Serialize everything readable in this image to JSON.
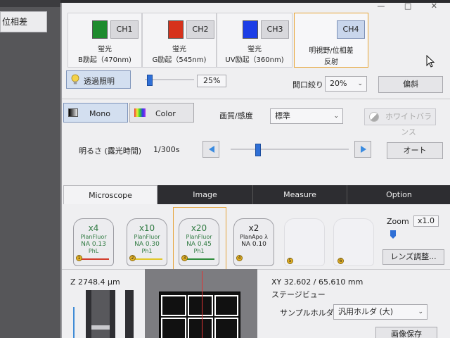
{
  "left": {
    "button_label": "位相差"
  },
  "window": {
    "controls": "—  □  ✕"
  },
  "channels": [
    {
      "label": "CH1",
      "name": "蛍光",
      "desc": "B励起（470nm)",
      "color": "#1f8b2e"
    },
    {
      "label": "CH2",
      "name": "蛍光",
      "desc": "G励起（545nm)",
      "color": "#d6321c"
    },
    {
      "label": "CH3",
      "name": "蛍光",
      "desc": "UV励起（360nm)",
      "color": "#1c3ee6"
    },
    {
      "label": "CH4",
      "name": "明視野/位相差",
      "desc": "反射",
      "color": ""
    }
  ],
  "illumination": {
    "button": "透過照明",
    "percent": "25%",
    "progress": 0.05,
    "aperture_label": "開口絞り",
    "aperture_value": "20%",
    "oblique_button": "偏斜"
  },
  "mode": {
    "mono": "Mono",
    "color": "Color",
    "quality_label": "画質/感度",
    "quality_value": "標準",
    "white_balance": "ホワイトバランス"
  },
  "brightness": {
    "label": "明るさ (露光時間)",
    "value": "1/300s",
    "auto": "オート",
    "slider_value": 0.22
  },
  "tabs": [
    "Microscope",
    "Image",
    "Measure",
    "Option"
  ],
  "lenses": [
    {
      "mag": "x4",
      "name": "PlanFluor",
      "na": "NA 0.13",
      "ph": "PhL",
      "band": "#d23b2b",
      "pos": "1"
    },
    {
      "mag": "x10",
      "name": "PlanFluor",
      "na": "NA 0.30",
      "ph": "Ph1",
      "band": "#e1c628",
      "pos": "2"
    },
    {
      "mag": "x20",
      "name": "PlanFluor",
      "na": "NA 0.45",
      "ph": "Ph1",
      "band": "#2d8b3a",
      "pos": "3"
    },
    {
      "mag": "x2",
      "name": "PlanApo λ",
      "na": "NA 0.10",
      "ph": "",
      "band": "",
      "pos": "4"
    },
    {
      "mag": "",
      "name": "",
      "na": "",
      "ph": "",
      "band": "",
      "pos": "5"
    },
    {
      "mag": "",
      "name": "",
      "na": "",
      "ph": "",
      "band": "",
      "pos": "6"
    }
  ],
  "zoom": {
    "label": "Zoom",
    "value": "x1.0",
    "lens_adjust": "レンズ調整..."
  },
  "stage": {
    "z": "Z  2748.4 μm",
    "xy": "XY   32.602 / 65.610 mm",
    "view_label": "ステージビュー",
    "holder_label": "サンプルホルダ",
    "holder_value": "汎用ホルダ (大)",
    "save_button": "画像保存"
  }
}
